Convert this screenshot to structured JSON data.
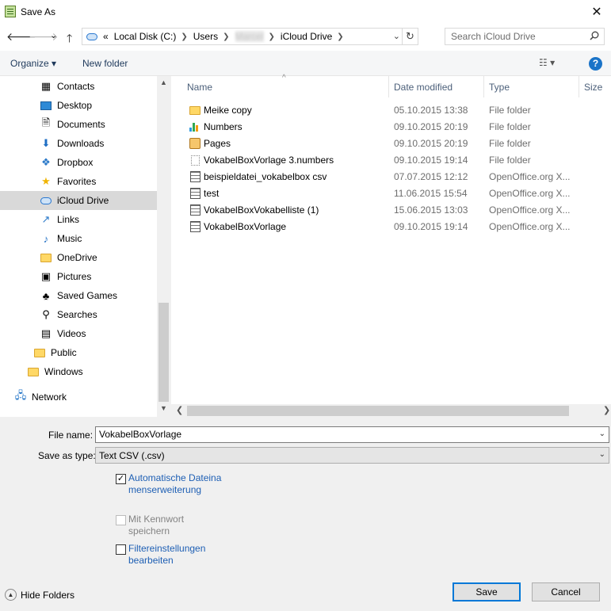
{
  "window": {
    "title": "Save As",
    "close_glyph": "✕",
    "icon": "numbers-app-icon"
  },
  "nav": {
    "back": "🡐",
    "forward": "🡒",
    "recent": "⌄",
    "up": "🡑"
  },
  "address": {
    "overflow": "«",
    "crumbs": [
      "Local Disk (C:)",
      "Users",
      "Marcel",
      "iCloud Drive"
    ],
    "dropdown": "⌄",
    "refresh": "↻"
  },
  "search": {
    "placeholder": "Search iCloud Drive"
  },
  "toolbar": {
    "organize": "Organize ▾",
    "new_folder": "New folder",
    "view": "☷ ▾",
    "help": "?"
  },
  "sidebar": {
    "items": [
      {
        "label": "Contacts",
        "icon": "contacts-icon"
      },
      {
        "label": "Desktop",
        "icon": "desktop-icon"
      },
      {
        "label": "Documents",
        "icon": "documents-icon"
      },
      {
        "label": "Downloads",
        "icon": "downloads-icon"
      },
      {
        "label": "Dropbox",
        "icon": "dropbox-icon"
      },
      {
        "label": "Favorites",
        "icon": "favorites-star-icon"
      },
      {
        "label": "iCloud Drive",
        "icon": "icloud-icon",
        "selected": true
      },
      {
        "label": "Links",
        "icon": "links-icon"
      },
      {
        "label": "Music",
        "icon": "music-note-icon"
      },
      {
        "label": "OneDrive",
        "icon": "folder-icon"
      },
      {
        "label": "Pictures",
        "icon": "pictures-icon"
      },
      {
        "label": "Saved Games",
        "icon": "saved-games-icon"
      },
      {
        "label": "Searches",
        "icon": "search-icon"
      },
      {
        "label": "Videos",
        "icon": "videos-icon"
      },
      {
        "label": "Public",
        "icon": "folder-icon"
      },
      {
        "label": "Windows",
        "icon": "folder-icon"
      },
      {
        "label": "Network",
        "icon": "network-icon"
      }
    ]
  },
  "files": {
    "columns": {
      "name": "Name",
      "date": "Date modified",
      "type": "Type",
      "size": "Size"
    },
    "sort_glyph": "^",
    "rows": [
      {
        "name": "Meike copy",
        "date": "05.10.2015 13:38",
        "type": "File folder",
        "icon": "folder-icon"
      },
      {
        "name": "Numbers",
        "date": "09.10.2015 20:19",
        "type": "File folder",
        "icon": "numbers-icon"
      },
      {
        "name": "Pages",
        "date": "09.10.2015 20:19",
        "type": "File folder",
        "icon": "pages-icon"
      },
      {
        "name": "VokabelBoxVorlage 3.numbers",
        "date": "09.10.2015 19:14",
        "type": "File folder",
        "icon": "file-icon"
      },
      {
        "name": "beispieldatei_vokabelbox csv",
        "date": "07.07.2015 12:12",
        "type": "OpenOffice.org X...",
        "icon": "spreadsheet-icon"
      },
      {
        "name": "test",
        "date": "11.06.2015 15:54",
        "type": "OpenOffice.org X...",
        "icon": "spreadsheet-icon"
      },
      {
        "name": "VokabelBoxVokabelliste (1)",
        "date": "15.06.2015 13:03",
        "type": "OpenOffice.org X...",
        "icon": "spreadsheet-icon"
      },
      {
        "name": "VokabelBoxVorlage",
        "date": "09.10.2015 19:14",
        "type": "OpenOffice.org X...",
        "icon": "spreadsheet-icon"
      }
    ]
  },
  "form": {
    "file_name_label": "File name:",
    "file_name_value": "VokabelBoxVorlage",
    "save_type_label": "Save as type:",
    "save_type_value": "Text CSV (.csv)",
    "options": [
      {
        "label": "Automatische Dateinamenserweiterung",
        "checked": true,
        "enabled": true
      },
      {
        "label": "Mit Kennwort speichern",
        "checked": false,
        "enabled": false
      },
      {
        "label": "Filtereinstellungen bearbeiten",
        "checked": false,
        "enabled": true
      }
    ],
    "check_glyph": "✓"
  },
  "footer": {
    "hide_folders": "Hide Folders",
    "hide_glyph": "▲",
    "save": "Save",
    "cancel": "Cancel"
  },
  "colors": {
    "accent": "#0078d7",
    "selection": "#d9d9d9",
    "link": "#1e5fb4"
  }
}
